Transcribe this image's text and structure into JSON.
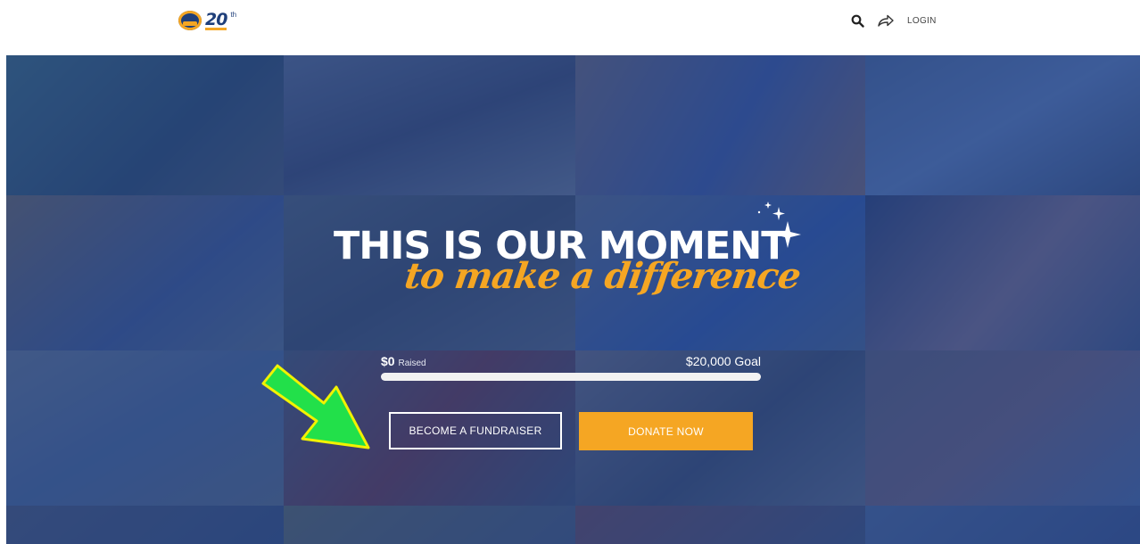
{
  "header": {
    "logo_text": "20",
    "logo_sup": "th",
    "icons": [
      "search-icon",
      "share-icon"
    ],
    "login_label": "LOGIN"
  },
  "hero": {
    "headline_main": "THIS IS OUR MOMENT",
    "headline_sub": "to make a difference",
    "raised_amount": "$0",
    "raised_caption": "Raised",
    "goal_text": "$20,000 Goal",
    "progress_fraction": 0.0,
    "fundraiser_label": "BECOME A FUNDRAISER",
    "donate_label": "DONATE NOW"
  },
  "colors": {
    "brand_blue": "#1f3f7a",
    "accent_orange": "#f5a623",
    "overlay_blue": "#2c4a88",
    "arrow_green": "#22e04a",
    "arrow_outline": "#f2f200"
  }
}
